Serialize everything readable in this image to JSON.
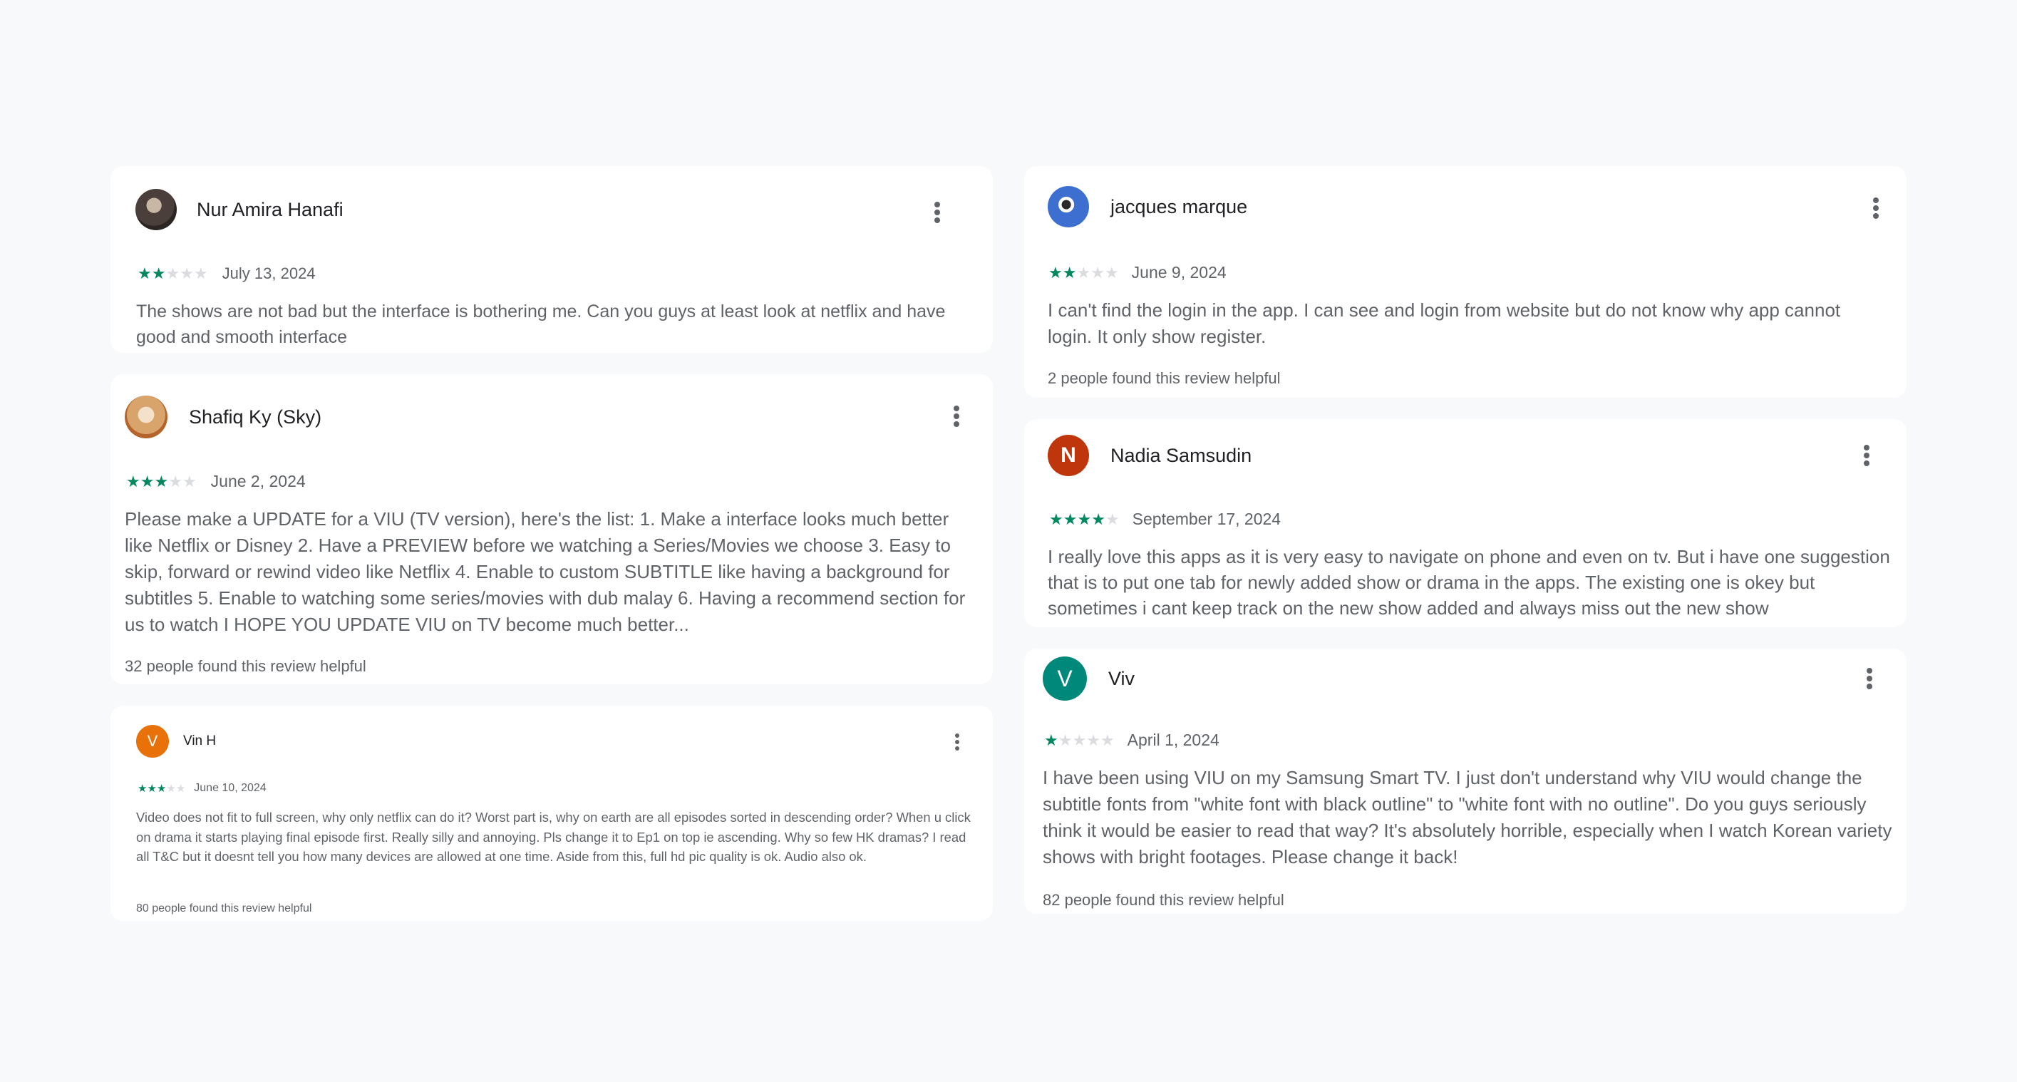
{
  "colors": {
    "star_on": "#01875f",
    "star_off": "#dadce0",
    "card_bg": "#ffffff",
    "page_bg": "#f8f9fb"
  },
  "reviews": [
    {
      "name": "Nur Amira Hanafi",
      "avatar_letter": "",
      "avatar_icon": "profile-photo",
      "rating": 2,
      "date": "July 13, 2024",
      "text": "The shows are not bad but the interface is bothering me. Can you guys at least look at netflix and have good and smooth interface",
      "helpful": ""
    },
    {
      "name": "Shafiq Ky (Sky)",
      "avatar_letter": "",
      "avatar_icon": "profile-photo",
      "rating": 3,
      "date": "June 2, 2024",
      "text": "Please make a UPDATE for a VIU (TV version), here's the list: 1. Make a interface looks much better like Netflix or Disney 2. Have a PREVIEW before we watching a Series/Movies we choose 3. Easy to skip, forward or rewind video like Netflix 4. Enable to custom SUBTITLE like having a background for subtitles 5. Enable to watching some series/movies with dub malay 6. Having a recommend section for us to watch I HOPE YOU UPDATE VIU on TV become much better...",
      "helpful": "32 people found this review helpful"
    },
    {
      "name": "Vin H",
      "avatar_letter": "V",
      "avatar_color": "#e8710a",
      "rating": 3,
      "date": "June 10, 2024",
      "text": "Video does not fit to full screen, why only netflix can do it? Worst part is, why on earth are all episodes sorted in descending order? When u click on drama it starts playing final episode first. Really silly and annoying. Pls change it to Ep1 on top ie ascending. Why so few HK dramas? I read all T&C but it doesnt tell you how many devices are allowed at one time. Aside from this, full hd pic quality is ok. Audio also ok.",
      "helpful": "80 people found this review helpful"
    },
    {
      "name": "jacques marque",
      "avatar_letter": "",
      "avatar_icon": "profile-photo",
      "rating": 2,
      "date": "June 9, 2024",
      "text": "I can't find the login in the app. I can see and login from website but do not know why app cannot login. It only show register.",
      "helpful": "2 people found this review helpful"
    },
    {
      "name": "Nadia Samsudin",
      "avatar_letter": "N",
      "avatar_color": "#bf360c",
      "rating": 4,
      "date": "September 17, 2024",
      "text": "I really love this apps as it is very easy to navigate on phone and even on tv. But i have one suggestion that is to put one tab for newly added show or drama in the apps. The existing one is okey but sometimes i cant keep track on the new show added and always miss out the new show",
      "helpful": ""
    },
    {
      "name": "Viv",
      "avatar_letter": "V",
      "avatar_color": "#00897b",
      "rating": 1,
      "date": "April 1, 2024",
      "text": "I have been using VIU on my Samsung Smart TV. I just don't understand why VIU would change the subtitle fonts from \"white font with black outline\" to \"white font with no outline\". Do you guys seriously think it would be easier to read that way? It's absolutely horrible, especially when I watch Korean variety shows with bright footages. Please change it back!",
      "helpful": "82 people found this review helpful"
    }
  ]
}
